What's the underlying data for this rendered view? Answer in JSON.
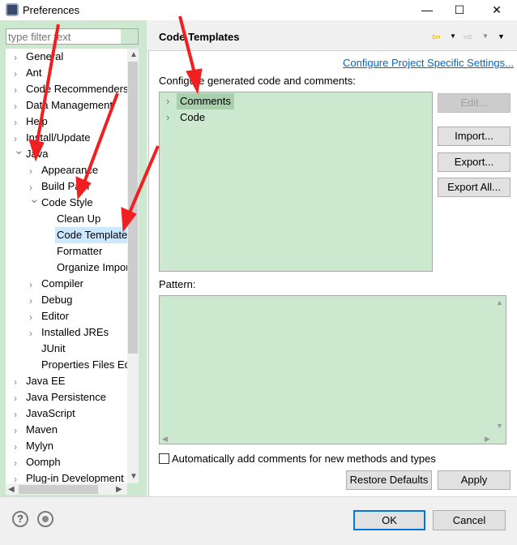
{
  "window": {
    "title": "Preferences",
    "minimize": "—",
    "maximize": "☐",
    "close": "✕"
  },
  "filter": {
    "placeholder": "type filter text"
  },
  "tree": [
    {
      "label": "General",
      "level": 0,
      "expander": "collapsed"
    },
    {
      "label": "Ant",
      "level": 0,
      "expander": "collapsed"
    },
    {
      "label": "Code Recommenders",
      "level": 0,
      "expander": "collapsed"
    },
    {
      "label": "Data Management",
      "level": 0,
      "expander": "collapsed"
    },
    {
      "label": "Help",
      "level": 0,
      "expander": "collapsed"
    },
    {
      "label": "Install/Update",
      "level": 0,
      "expander": "collapsed"
    },
    {
      "label": "Java",
      "level": 0,
      "expander": "expanded"
    },
    {
      "label": "Appearance",
      "level": 1,
      "expander": "collapsed"
    },
    {
      "label": "Build Path",
      "level": 1,
      "expander": "collapsed"
    },
    {
      "label": "Code Style",
      "level": 1,
      "expander": "expanded"
    },
    {
      "label": "Clean Up",
      "level": 2,
      "expander": "none"
    },
    {
      "label": "Code Templates",
      "level": 2,
      "expander": "none",
      "selected": true
    },
    {
      "label": "Formatter",
      "level": 2,
      "expander": "none"
    },
    {
      "label": "Organize Imports",
      "level": 2,
      "expander": "none"
    },
    {
      "label": "Compiler",
      "level": 1,
      "expander": "collapsed"
    },
    {
      "label": "Debug",
      "level": 1,
      "expander": "collapsed"
    },
    {
      "label": "Editor",
      "level": 1,
      "expander": "collapsed"
    },
    {
      "label": "Installed JREs",
      "level": 1,
      "expander": "collapsed"
    },
    {
      "label": "JUnit",
      "level": 1,
      "expander": "none"
    },
    {
      "label": "Properties Files Editor",
      "level": 1,
      "expander": "none"
    },
    {
      "label": "Java EE",
      "level": 0,
      "expander": "collapsed"
    },
    {
      "label": "Java Persistence",
      "level": 0,
      "expander": "collapsed"
    },
    {
      "label": "JavaScript",
      "level": 0,
      "expander": "collapsed"
    },
    {
      "label": "Maven",
      "level": 0,
      "expander": "collapsed"
    },
    {
      "label": "Mylyn",
      "level": 0,
      "expander": "collapsed"
    },
    {
      "label": "Oomph",
      "level": 0,
      "expander": "collapsed"
    },
    {
      "label": "Plug-in Development",
      "level": 0,
      "expander": "collapsed"
    }
  ],
  "page": {
    "title": "Code Templates",
    "link": "Configure Project Specific Settings...",
    "configure_label": "Configure generated code and comments:",
    "templates": [
      {
        "label": "Comments",
        "selected": true
      },
      {
        "label": "Code"
      }
    ],
    "buttons": {
      "edit": "Edit...",
      "import": "Import...",
      "export": "Export...",
      "export_all": "Export All..."
    },
    "pattern_label": "Pattern:",
    "auto_comments": {
      "label": "Automatically add comments for new methods and types",
      "checked": false
    },
    "restore": "Restore Defaults",
    "apply": "Apply"
  },
  "footer": {
    "ok": "OK",
    "cancel": "Cancel",
    "help_icon": "?"
  },
  "colors": {
    "editor_bg": "#cce8cf",
    "link": "#0066cc",
    "annotation_arrow": "#f02020"
  }
}
